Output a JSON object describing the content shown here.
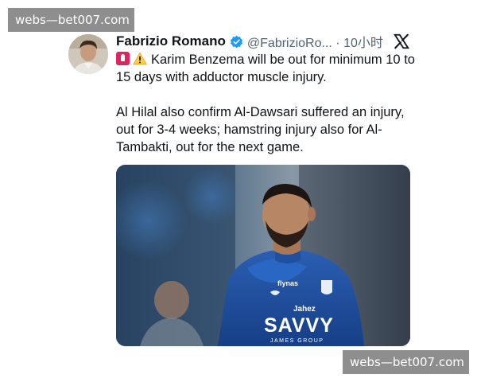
{
  "watermark": {
    "top": "webs—bet007.com",
    "bottom": "webs—bet007.com"
  },
  "tweet": {
    "author": "Fabrizio Romano",
    "handle": "@FabrizioRo... · 10小时",
    "line1": "Karim Benzema will be out for minimum 10 to 15 days with adductor muscle injury.",
    "line2": "Al Hilal also confirm Al-Dawsari suffered an injury, out for 3-4 weeks; hamstring injury also for Al-Tambakti, out for the next game."
  },
  "jersey": {
    "sponsor": "SAVVY",
    "sponsor_sub": "JAMES GROUP",
    "chest_top": "Jahez",
    "kit_brand": "flynas"
  },
  "icons": {
    "verified": "verified-badge-icon",
    "x": "x-logo-icon",
    "siren": "rotating-light-emoji",
    "warning": "warning-emoji"
  },
  "colors": {
    "verified_blue": "#1d9bf0",
    "handle_gray": "#536471",
    "watermark_bg": "#8e8e8e"
  }
}
